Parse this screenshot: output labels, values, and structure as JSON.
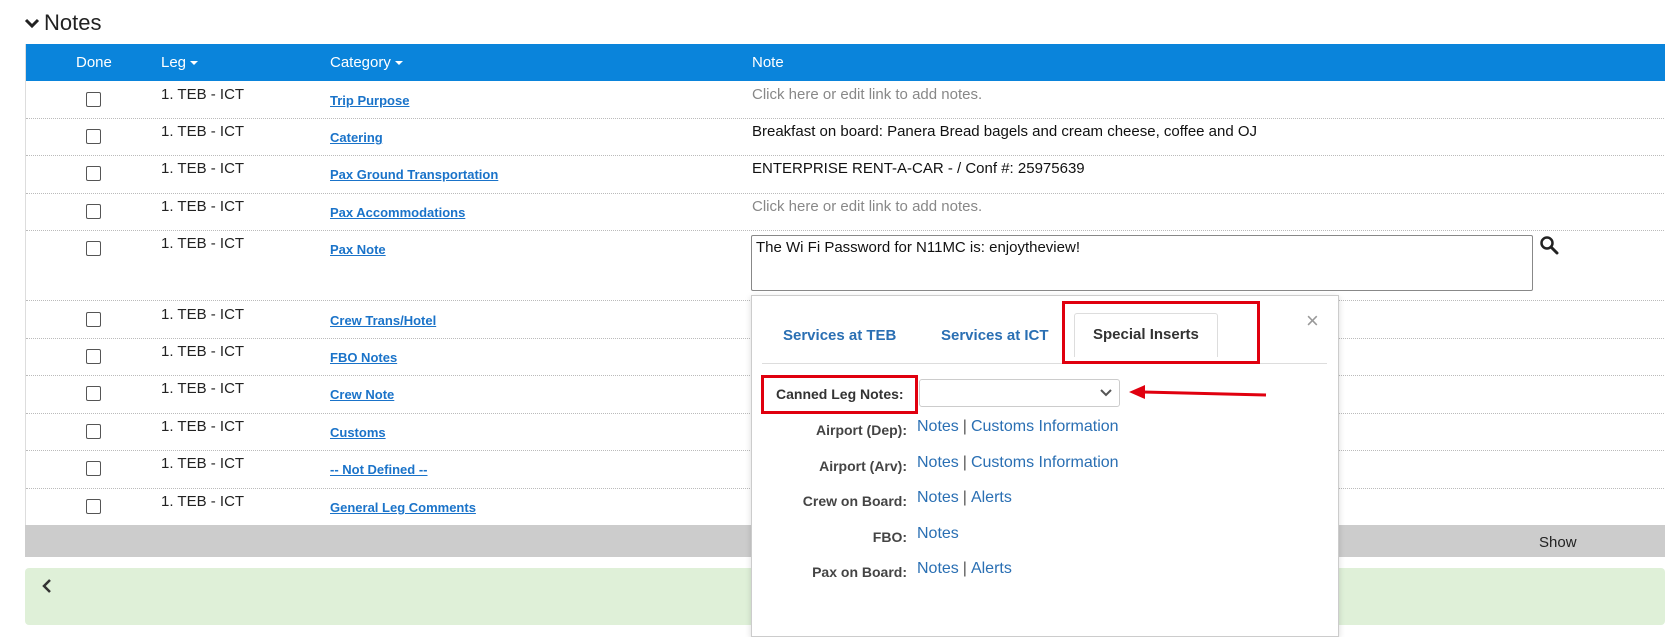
{
  "section": {
    "title": "Notes"
  },
  "table": {
    "headers": {
      "done": "Done",
      "leg": "Leg",
      "category": "Category",
      "note": "Note"
    },
    "rows": [
      {
        "leg": "1. TEB - ICT",
        "category": "Trip Purpose",
        "note": "Click here or edit link to add notes."
      },
      {
        "leg": "1. TEB - ICT",
        "category": "Catering",
        "note": "Breakfast on board: Panera Bread bagels and cream cheese, coffee and OJ"
      },
      {
        "leg": "1. TEB - ICT",
        "category": "Pax Ground Transportation",
        "note": "ENTERPRISE RENT-A-CAR - / Conf #: 25975639"
      },
      {
        "leg": "1. TEB - ICT",
        "category": "Pax Accommodations",
        "note": "Click here or edit link to add notes."
      },
      {
        "leg": "1. TEB - ICT",
        "category": "Pax Note",
        "note": "The Wi Fi Password for N11MC is:  enjoytheview!"
      },
      {
        "leg": "1. TEB - ICT",
        "category": "Crew Trans/Hotel",
        "note": ""
      },
      {
        "leg": "1. TEB - ICT",
        "category": "FBO Notes",
        "note": ""
      },
      {
        "leg": "1. TEB - ICT",
        "category": "Crew Note",
        "note": ""
      },
      {
        "leg": "1. TEB - ICT",
        "category": "Customs",
        "note": ""
      },
      {
        "leg": "1. TEB - ICT",
        "category": "-- Not Defined --",
        "note": ""
      },
      {
        "leg": "1. TEB - ICT",
        "category": "General Leg Comments",
        "note": ""
      }
    ],
    "footer": {
      "show_text": "Show"
    }
  },
  "popup": {
    "tabs": [
      "Services at TEB",
      "Services at ICT",
      "Special Inserts"
    ],
    "active_tab": "Special Inserts",
    "close": "×",
    "canned_label": "Canned Leg Notes:",
    "canned_value": "",
    "rows": [
      {
        "label": "Airport (Dep):",
        "links": [
          "Notes",
          "Customs Information"
        ]
      },
      {
        "label": "Airport (Arv):",
        "links": [
          "Notes",
          "Customs Information"
        ]
      },
      {
        "label": "Crew on Board:",
        "links": [
          "Notes",
          "Alerts"
        ]
      },
      {
        "label": "FBO:",
        "links": [
          "Notes"
        ]
      },
      {
        "label": "Pax on Board:",
        "links": [
          "Notes",
          "Alerts"
        ]
      }
    ],
    "separator": "|"
  },
  "colors": {
    "header_bg": "#0a84db",
    "link": "#1a73c9",
    "highlight": "#e0000f",
    "footer_bg": "#cccccc",
    "banner_bg": "#dff0d8"
  },
  "icons": {
    "collapse": "chevron-down-icon",
    "search": "search-icon",
    "close": "close-icon",
    "dropdown": "chevron-down-icon"
  }
}
